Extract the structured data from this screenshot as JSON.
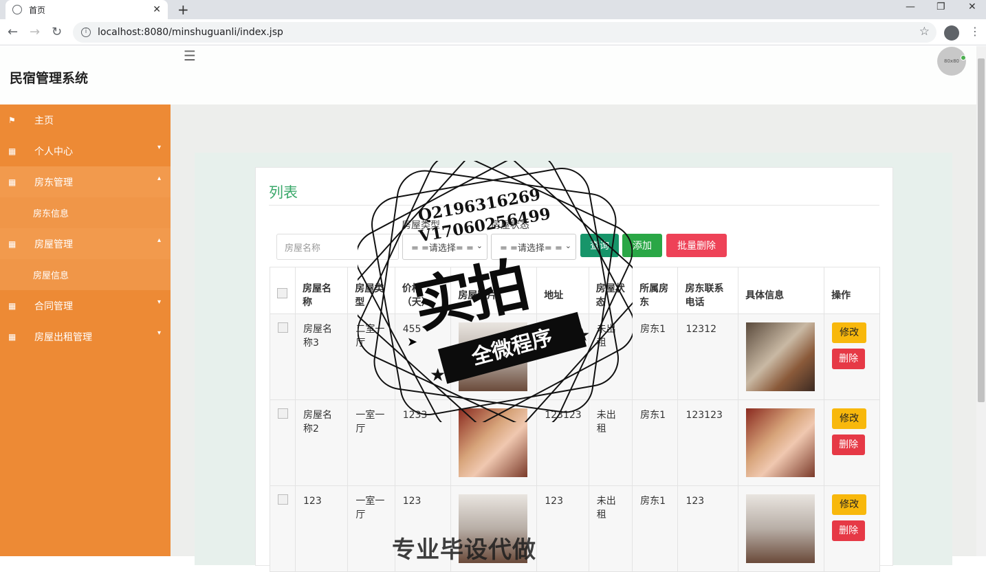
{
  "browser": {
    "tab_title": "首页",
    "url": "localhost:8080/minshuguanli/index.jsp"
  },
  "header": {
    "brand": "民宿管理系统",
    "avatar_text": "80x80"
  },
  "sidebar": {
    "items": [
      {
        "label": "主页"
      },
      {
        "label": "个人中心"
      },
      {
        "label": "房东管理"
      },
      {
        "label": "房东信息"
      },
      {
        "label": "房屋管理"
      },
      {
        "label": "房屋信息"
      },
      {
        "label": "合同管理"
      },
      {
        "label": "房屋出租管理"
      }
    ]
  },
  "panel": {
    "title": "列表",
    "filters": {
      "type_label": "房屋类型",
      "status_label": "房屋状态",
      "name_placeholder": "房屋名称",
      "type_select": "= =请选择= =",
      "status_select": "= =请选择= ="
    },
    "buttons": {
      "search": "查询",
      "add": "添加",
      "batch_delete": "批量删除"
    },
    "columns": [
      "房屋名称",
      "房屋类型",
      "价格（天）",
      "房屋图片",
      "地址",
      "房屋状态",
      "所属房东",
      "房东联系电话",
      "具体信息",
      "操作"
    ],
    "rows": [
      {
        "name": "房屋名称3",
        "type": "二室一厅",
        "price": "455",
        "address": "",
        "status": "未出租",
        "landlord": "房东1",
        "phone": "12312"
      },
      {
        "name": "房屋名称2",
        "type": "一室一厅",
        "price": "1233",
        "address": "123123",
        "status": "未出租",
        "landlord": "房东1",
        "phone": "123123"
      },
      {
        "name": "123",
        "type": "一室一厅",
        "price": "123",
        "address": "123",
        "status": "未出租",
        "landlord": "房东1",
        "phone": "123"
      }
    ],
    "row_actions": {
      "edit": "修改",
      "delete": "删除"
    }
  },
  "watermark": {
    "line1": "Q2196316269",
    "line2": "V17060256499",
    "big": "实拍",
    "ribbon": "全微程序",
    "bottom": "专业毕设代做"
  }
}
